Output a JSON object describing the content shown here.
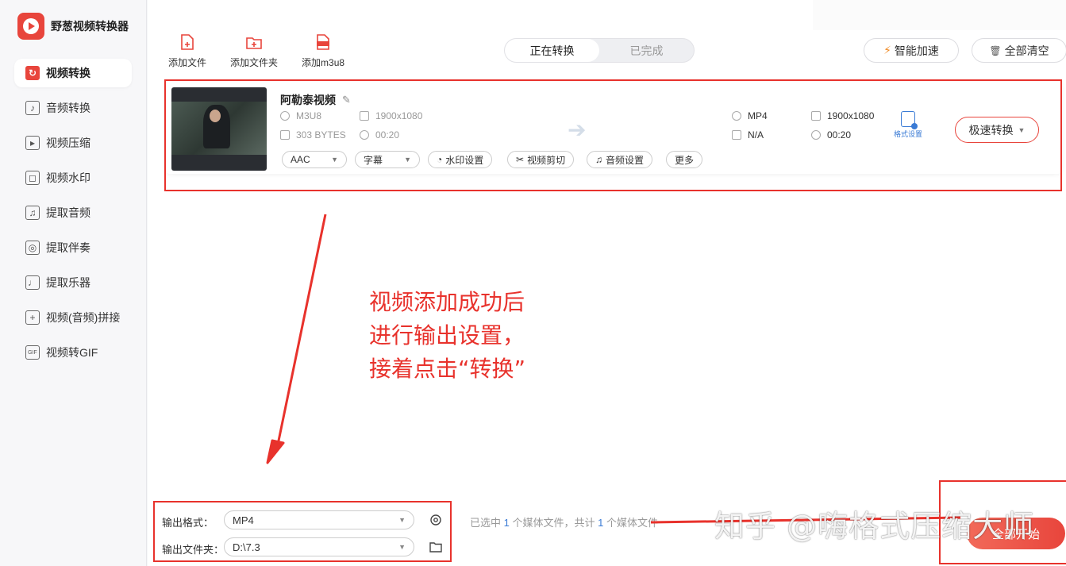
{
  "app": {
    "name": "野葱视频转换器"
  },
  "sidebar": {
    "items": [
      {
        "label": "视频转换",
        "icon": "video-convert-icon",
        "active": true
      },
      {
        "label": "音频转换",
        "icon": "audio-convert-icon"
      },
      {
        "label": "视频压缩",
        "icon": "video-compress-icon"
      },
      {
        "label": "视频水印",
        "icon": "video-watermark-icon"
      },
      {
        "label": "提取音频",
        "icon": "extract-audio-icon"
      },
      {
        "label": "提取伴奏",
        "icon": "extract-accompaniment-icon"
      },
      {
        "label": "提取乐器",
        "icon": "guitar-icon"
      },
      {
        "label": "视频(音频)拼接",
        "icon": "merge-icon"
      },
      {
        "label": "视频转GIF",
        "icon": "gif-icon"
      }
    ]
  },
  "toolbar": {
    "add_file": "添加文件",
    "add_folder": "添加文件夹",
    "add_m3u8": "添加m3u8"
  },
  "tabs": {
    "converting": "正在转换",
    "completed": "已完成"
  },
  "header_buttons": {
    "accelerate": "智能加速",
    "clear_all": "全部清空"
  },
  "file": {
    "title": "阿勒泰视频",
    "source": {
      "format": "M3U8",
      "resolution": "1900x1080",
      "size": "303 BYTES",
      "duration": "00:20"
    },
    "target": {
      "format": "MP4",
      "resolution": "1900x1080",
      "size": "N/A",
      "duration": "00:20"
    },
    "audio_select": "AAC",
    "subtitle_select": "字幕",
    "watermark_btn": "水印设置",
    "clip_btn": "视频剪切",
    "audio_btn": "音频设置",
    "more_btn": "更多",
    "format_settings": "格式设置",
    "speed_convert": "极速转换"
  },
  "annotation": {
    "line1": "视频添加成功后",
    "line2": "进行输出设置，",
    "line3": "接着点击“转换”"
  },
  "output": {
    "format_label": "输出格式：",
    "format_value": "MP4",
    "folder_label": "输出文件夹：",
    "folder_value": "D:\\7.3"
  },
  "status": {
    "prefix": "已选中",
    "selected": "1",
    "mid": "个媒体文件，共计",
    "total": "1",
    "suffix": "个媒体文件"
  },
  "start_all": "全部开始",
  "watermark": "知乎 @嗨格式压缩大师",
  "colors": {
    "accent": "#e8453c",
    "annotation_red": "#e8322c",
    "link_blue": "#3a7bd5"
  }
}
